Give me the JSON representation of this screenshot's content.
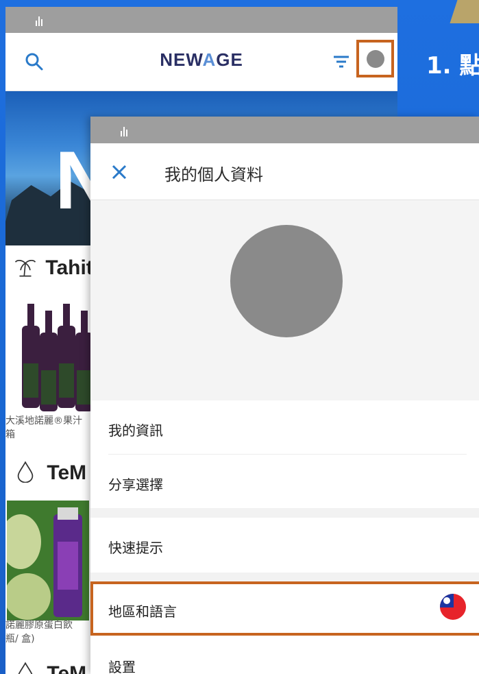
{
  "step_label": "1. 點",
  "back_screen": {
    "logo_left": "NEW",
    "logo_a": "A",
    "logo_right": "GE",
    "banner_letter": "N",
    "section1_title": "Tahit",
    "product1_caption_line1": "大溪地諾麗®果汁",
    "product1_caption_line2": "箱",
    "section2_title": "TeM",
    "product2_caption_line1": "諾麗膠原蛋白飲",
    "product2_caption_line2": "瓶/ 盒)",
    "section3_title": "TeM"
  },
  "front_screen": {
    "title": "我的個人資料",
    "menu": {
      "my_info": "我的資訊",
      "share_choice": "分享選擇",
      "quick_tips": "快速提示",
      "region_language": "地區和語言",
      "settings": "設置"
    }
  },
  "colors": {
    "background_blue": "#1a73e8",
    "highlight_orange": "#c7641f",
    "logo_navy": "#2a2f64",
    "icon_blue": "#2a7ac9"
  }
}
